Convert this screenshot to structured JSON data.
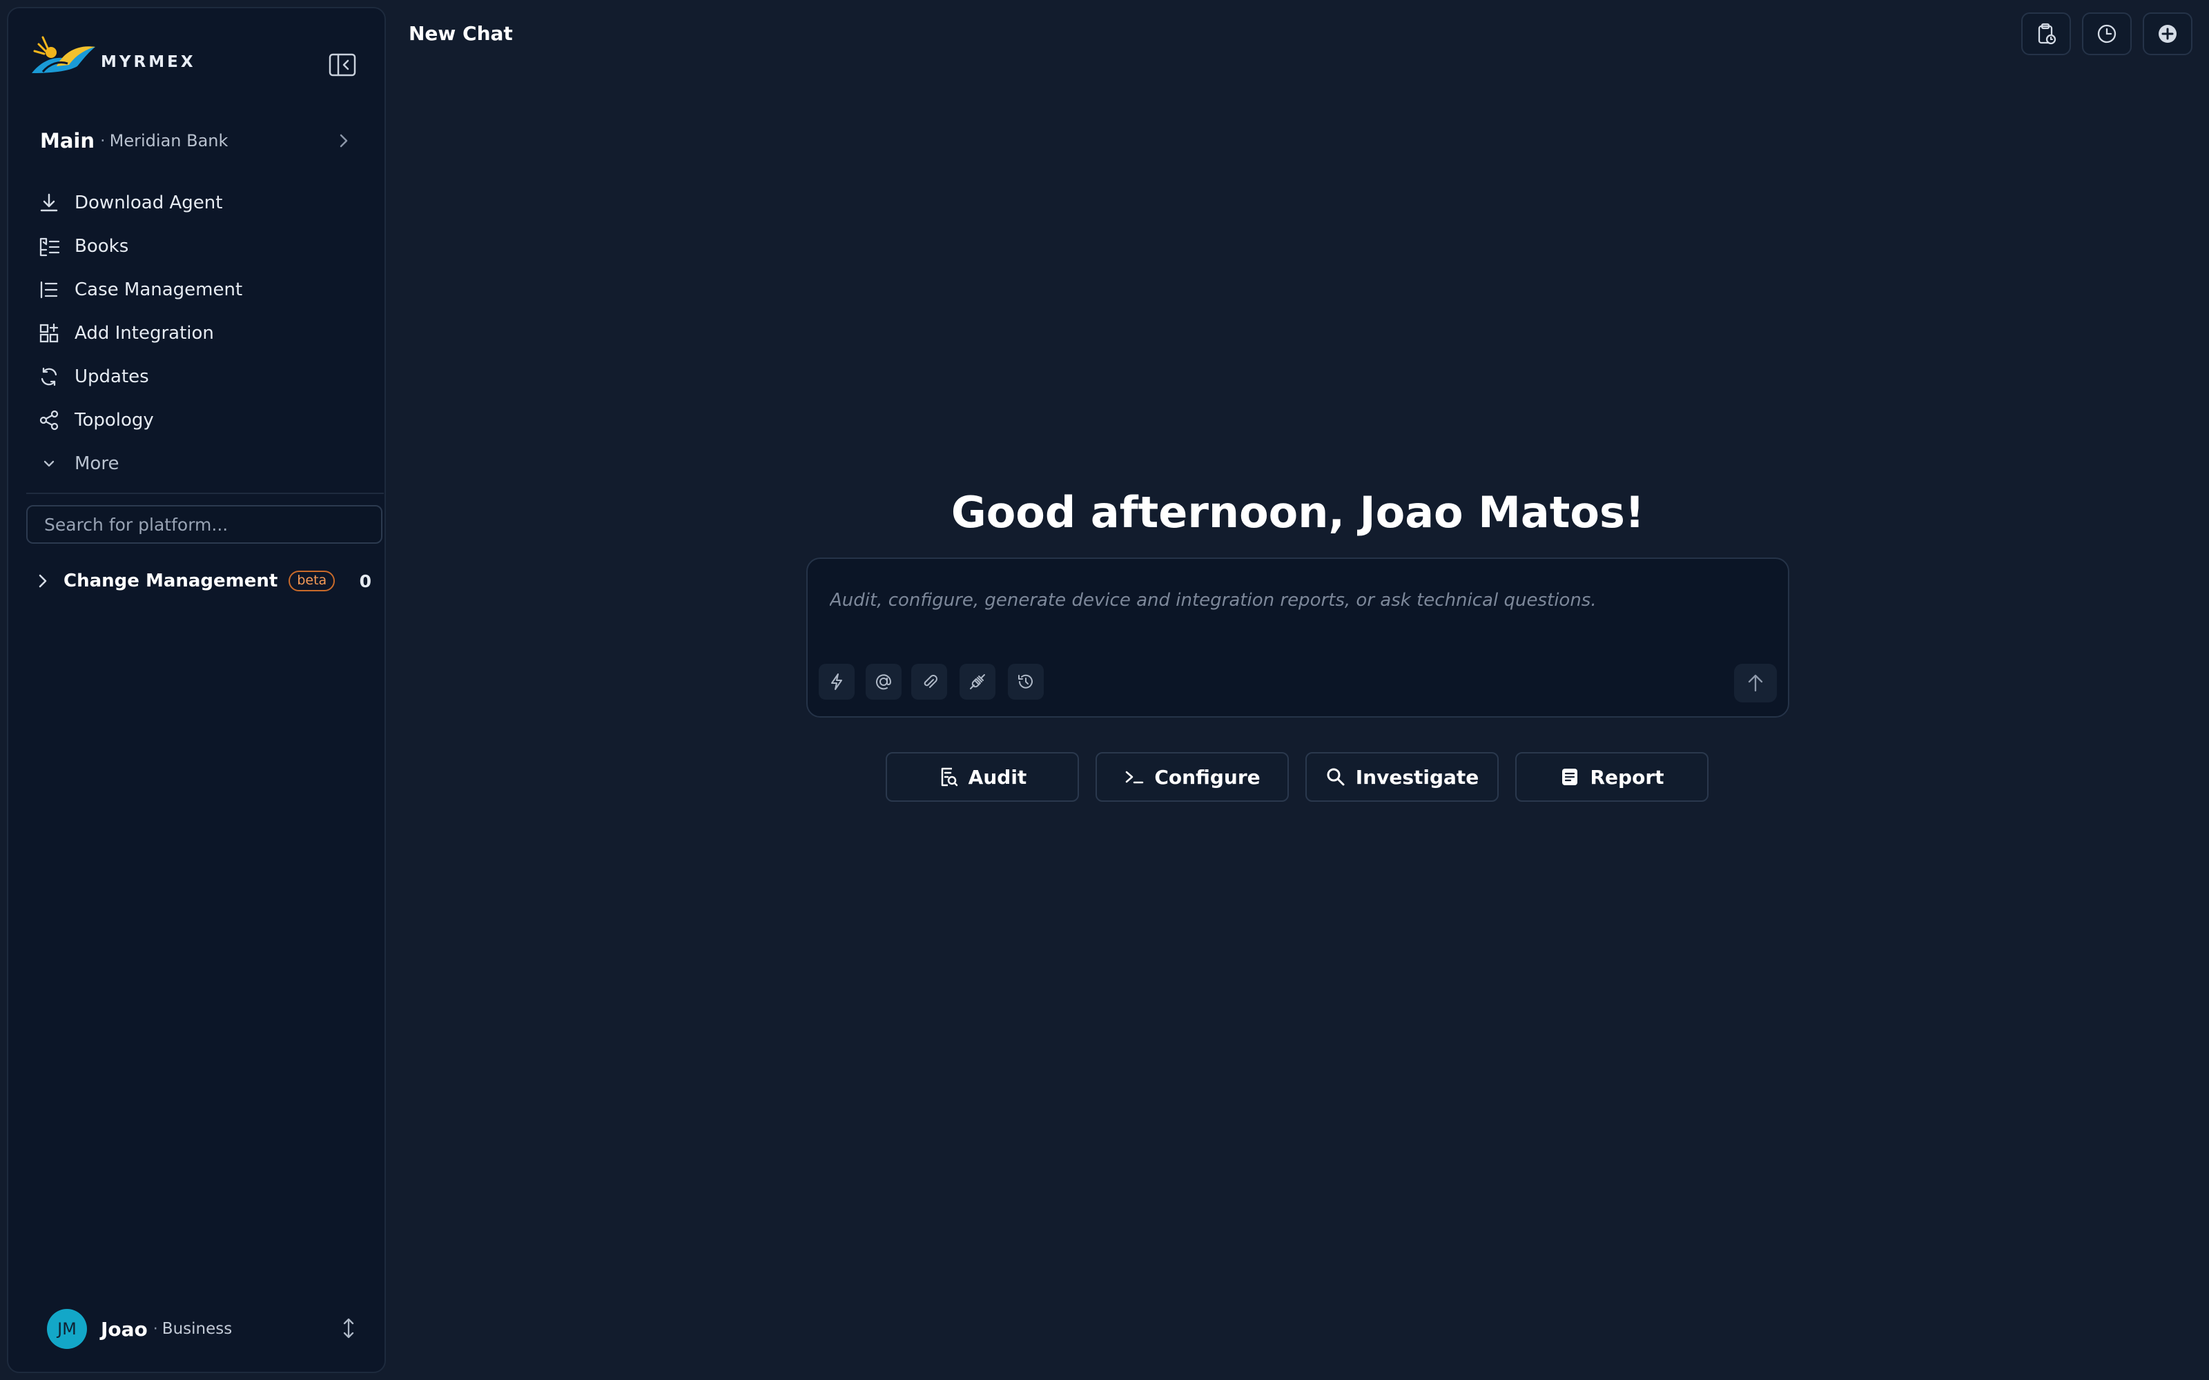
{
  "app": {
    "brand": "MYRMEX",
    "accent": "#13a7c8"
  },
  "header": {
    "title": "New Chat"
  },
  "workspace": {
    "name": "Main",
    "org": "Meridian Bank"
  },
  "nav": {
    "items": [
      {
        "label": "Download Agent",
        "icon": "download-icon"
      },
      {
        "label": "Books",
        "icon": "books-icon"
      },
      {
        "label": "Case Management",
        "icon": "list-icon"
      },
      {
        "label": "Add Integration",
        "icon": "grid-plus-icon"
      },
      {
        "label": "Updates",
        "icon": "refresh-icon"
      },
      {
        "label": "Topology",
        "icon": "share-nodes-icon"
      }
    ],
    "more_label": "More"
  },
  "search": {
    "placeholder": "Search for platform..."
  },
  "change_management": {
    "label": "Change Management",
    "badge": "beta",
    "count": "0"
  },
  "user": {
    "name": "Joao",
    "plan": "Business",
    "initials": "JM"
  },
  "main": {
    "greeting": "Good afternoon, Joao Matos!",
    "composer_placeholder": "Audit, configure, generate device and integration reports, or ask technical questions.",
    "actions": [
      {
        "label": "Audit",
        "icon": "audit-icon"
      },
      {
        "label": "Configure",
        "icon": "terminal-icon"
      },
      {
        "label": "Investigate",
        "icon": "search-icon"
      },
      {
        "label": "Report",
        "icon": "report-icon"
      }
    ]
  }
}
